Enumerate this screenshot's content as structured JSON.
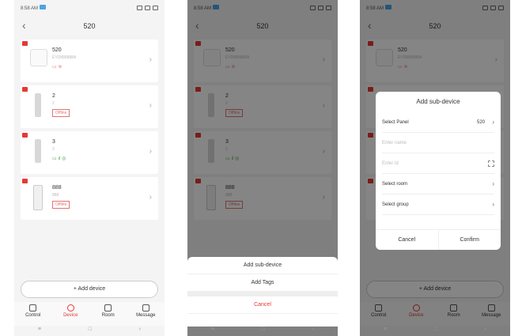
{
  "status": {
    "time": "8:58 AM"
  },
  "header": {
    "title": "520"
  },
  "devices": [
    {
      "name": "520",
      "sub": "EYD888888A"
    },
    {
      "name": "2",
      "sub": "2",
      "status": "Offline"
    },
    {
      "name": "3",
      "sub": "3"
    },
    {
      "name": "888",
      "sub": "888",
      "status": "Offline"
    }
  ],
  "add_button": "+ Add device",
  "tabs": [
    "Control",
    "Device",
    "Room",
    "Message"
  ],
  "sheet": {
    "add_subdevice": "Add sub-device",
    "add_tags": "Add Tags",
    "cancel": "Cancel"
  },
  "dialog": {
    "title": "Add sub-device",
    "select_panel": "Select Panel",
    "panel_value": "520",
    "name_placeholder": "Enter name",
    "id_placeholder": "Enter id",
    "select_room": "Select room",
    "select_group": "Select group",
    "cancel": "Cancel",
    "confirm": "Confirm"
  },
  "colors": {
    "accent": "#e53935",
    "online": "#43a047"
  }
}
